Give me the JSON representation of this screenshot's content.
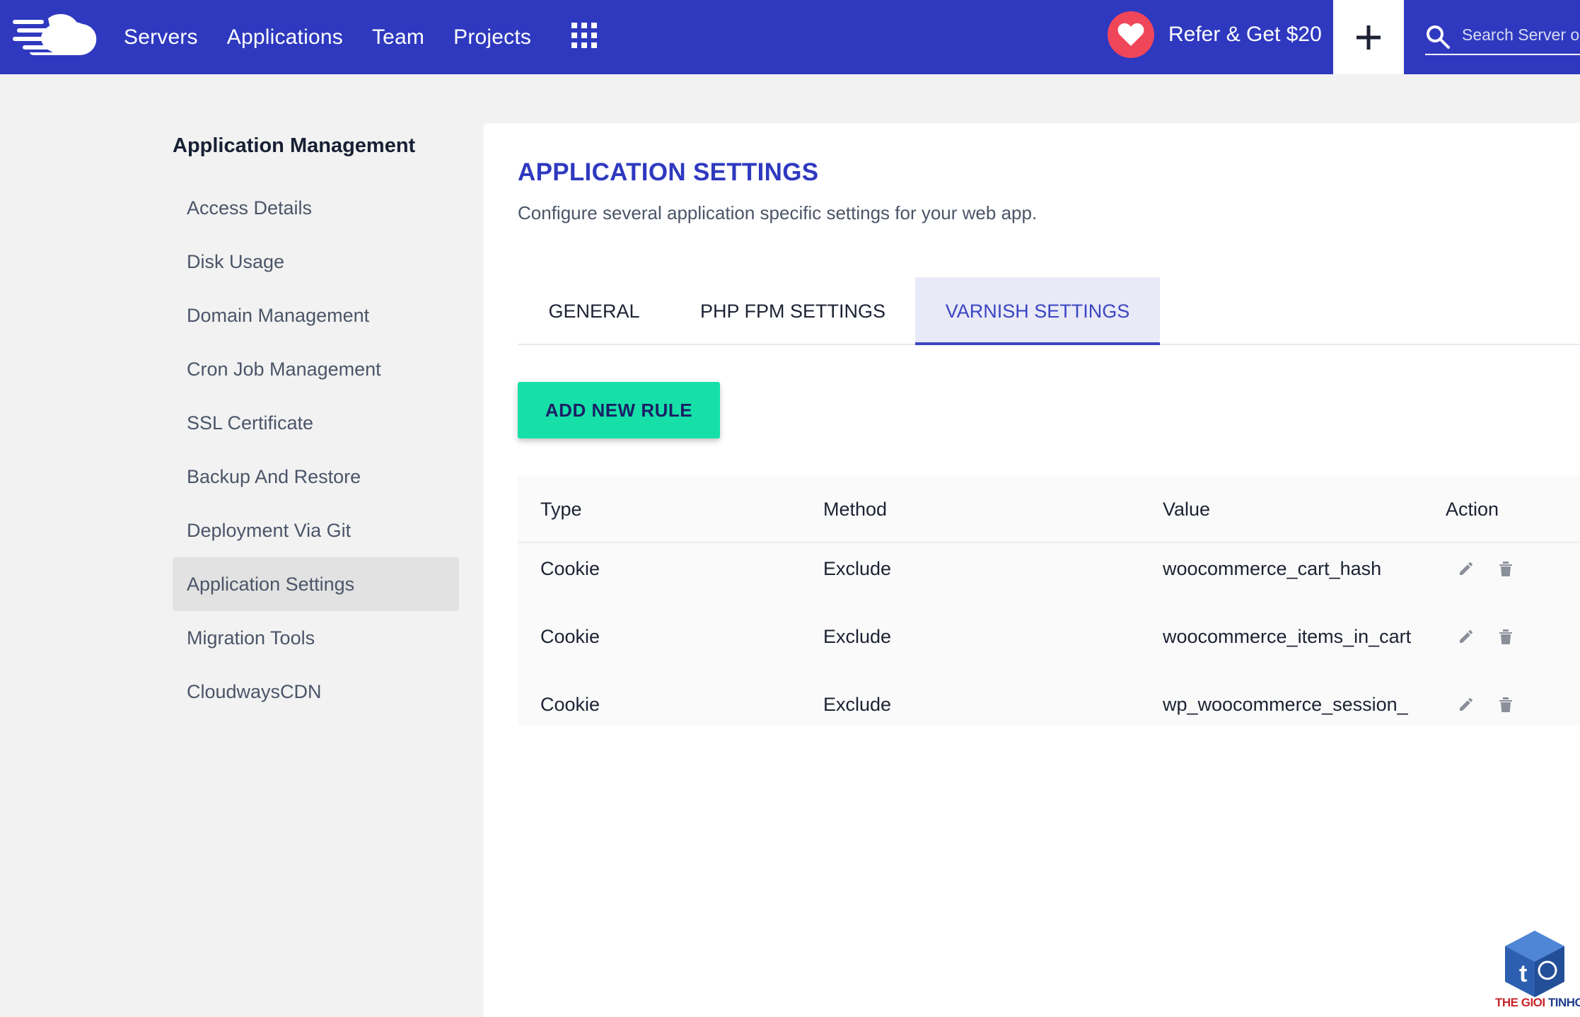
{
  "colors": {
    "brand": "#2f39bf",
    "accent_button": "#16e0a8",
    "heart_badge": "#f0465a",
    "active_tab_bg": "#e9eaf7",
    "active_sidebar_bg": "#e2e2e2"
  },
  "topbar": {
    "logo_icon": "cloudways-cloud-logo",
    "nav": [
      "Servers",
      "Applications",
      "Team",
      "Projects"
    ],
    "apps_icon": "grid-icon",
    "refer_label": "Refer & Get $20",
    "refer_icon": "heart-icon",
    "plus_icon": "plus-icon",
    "search_icon": "search-icon",
    "search_placeholder": "Search Server or Application"
  },
  "sidebar": {
    "heading": "Application Management",
    "items": [
      {
        "label": "Access Details",
        "active": false
      },
      {
        "label": "Disk Usage",
        "active": false
      },
      {
        "label": "Domain Management",
        "active": false
      },
      {
        "label": "Cron Job Management",
        "active": false
      },
      {
        "label": "SSL Certificate",
        "active": false
      },
      {
        "label": "Backup And Restore",
        "active": false
      },
      {
        "label": "Deployment Via Git",
        "active": false
      },
      {
        "label": "Application Settings",
        "active": true
      },
      {
        "label": "Migration Tools",
        "active": false
      },
      {
        "label": "CloudwaysCDN",
        "active": false
      }
    ]
  },
  "main": {
    "title": "APPLICATION SETTINGS",
    "subtitle": "Configure several application specific settings for your web app.",
    "tabs": [
      {
        "label": "GENERAL",
        "active": false
      },
      {
        "label": "PHP FPM SETTINGS",
        "active": false
      },
      {
        "label": "VARNISH SETTINGS",
        "active": true
      }
    ],
    "add_button": "ADD NEW RULE",
    "table": {
      "headers": [
        "Type",
        "Method",
        "Value",
        "Action"
      ],
      "rows": [
        {
          "type": "Cookie",
          "method": "Exclude",
          "value": "woocommerce_cart_hash",
          "actions": [
            "edit-icon",
            "trash-icon"
          ]
        },
        {
          "type": "Cookie",
          "method": "Exclude",
          "value": "woocommerce_items_in_cart",
          "actions": [
            "edit-icon",
            "trash-icon"
          ]
        },
        {
          "type": "Cookie",
          "method": "Exclude",
          "value": "wp_woocommerce_session_",
          "actions": [
            "edit-icon",
            "trash-icon"
          ]
        }
      ]
    }
  },
  "watermark": {
    "text_red": "THE GIOI",
    "text_blue": "TINHOC",
    "icon": "thegioitinhoc-logo"
  }
}
